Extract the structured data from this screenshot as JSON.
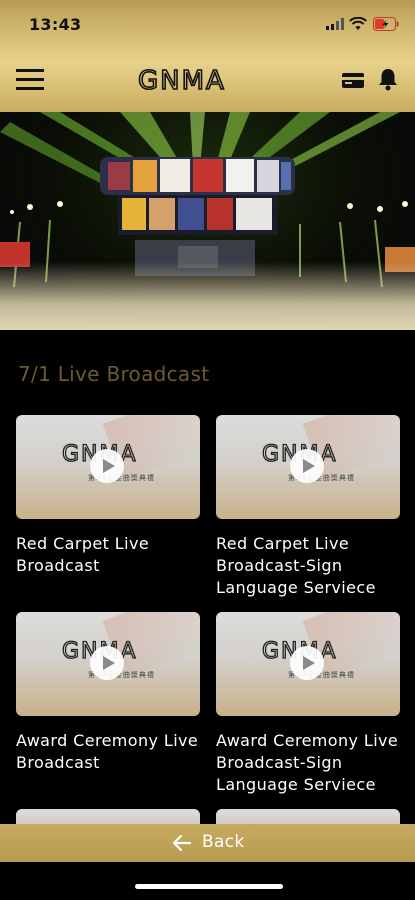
{
  "status": {
    "time": "13:43"
  },
  "header": {
    "logo_text": "GNMA"
  },
  "section": {
    "title": "7/1 Live Broadcast"
  },
  "thumbnail": {
    "logo_text": "GNMA",
    "subtitle": "第34屆金曲獎典禮"
  },
  "videos": [
    {
      "title": "Red Carpet Live Broadcast"
    },
    {
      "title": "Red Carpet Live Broadcast-Sign Language Serviece"
    },
    {
      "title": "Award Ceremony Live Broadcast"
    },
    {
      "title": "Award Ceremony Live Broadcast-Sign Language Serviece"
    }
  ],
  "footer": {
    "back_label": "Back"
  },
  "colors": {
    "gold": "#c7aa5f",
    "section_title": "#6e5a2a",
    "background": "#000000"
  },
  "icons": [
    "menu-icon",
    "card-icon",
    "bell-icon",
    "play-icon",
    "arrow-left-icon"
  ]
}
